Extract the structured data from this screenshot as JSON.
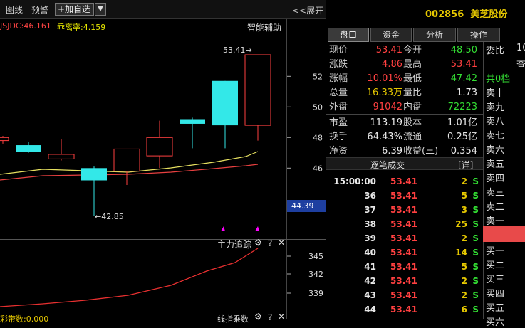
{
  "toolbar": {
    "items": [
      "图线",
      "预警"
    ],
    "add_label": "+加自选",
    "dropdown": "▼",
    "expand_label": "<<展开"
  },
  "indicators": {
    "left_label": "JSJDC:46.161",
    "deviation": "乖离率:4.159",
    "smart_aid": "智能辅助"
  },
  "chart_data": {
    "type": "candlestick",
    "candles": [
      {
        "open": 48.0,
        "close": 47.8,
        "high": 48.1,
        "low": 47.6,
        "color": "red"
      },
      {
        "open": 47.5,
        "close": 47.05,
        "high": 47.7,
        "low": 47.0,
        "color": "cyan"
      },
      {
        "open": 46.6,
        "close": 46.9,
        "high": 47.9,
        "low": 46.5,
        "color": "red"
      },
      {
        "open": 46.0,
        "close": 45.2,
        "high": 46.1,
        "low": 42.85,
        "color": "cyan"
      },
      {
        "open": 45.8,
        "close": 47.25,
        "high": 47.25,
        "low": 44.9,
        "color": "red"
      },
      {
        "open": 46.8,
        "close": 48.0,
        "high": 49.1,
        "low": 46.0,
        "color": "red"
      },
      {
        "open": 49.2,
        "close": 48.9,
        "high": 49.3,
        "low": 47.3,
        "color": "cyan"
      },
      {
        "open": 51.7,
        "close": 48.8,
        "high": 51.7,
        "low": 47.3,
        "color": "cyan"
      },
      {
        "open": 48.8,
        "close": 53.41,
        "high": 53.41,
        "low": 47.8,
        "color": "red"
      }
    ],
    "y_ticks": [
      "52",
      "50",
      "48",
      "46"
    ],
    "current_price": "44.39",
    "high_annotation": "53.41",
    "low_annotation": "42.85",
    "lower_y_ticks": [
      "345",
      "342",
      "339"
    ]
  },
  "lower_panel": {
    "title": "主力追踪",
    "bottom_left": "彩带数:0.000",
    "bottom_right": "线指乘数"
  },
  "stock": {
    "code": "002856",
    "name": "美芝股份"
  },
  "tabs": [
    "盘口",
    "资金",
    "分析",
    "操作"
  ],
  "quote": [
    {
      "l1": "现价",
      "v1": "53.41",
      "c1": "red",
      "l2": "今开",
      "v2": "48.50",
      "c2": "green"
    },
    {
      "l1": "涨跌",
      "v1": "4.86",
      "c1": "red",
      "l2": "最高",
      "v2": "53.41",
      "c2": "red"
    },
    {
      "l1": "涨幅",
      "v1": "10.01%",
      "c1": "red",
      "l2": "最低",
      "v2": "47.42",
      "c2": "green"
    },
    {
      "l1": "总量",
      "v1": "16.33万",
      "c1": "yellow",
      "l2": "量比",
      "v2": "1.73",
      "c2": "white"
    },
    {
      "l1": "外盘",
      "v1": "91042",
      "c1": "red",
      "l2": "内盘",
      "v2": "72223",
      "c2": "green"
    },
    {
      "l1": "市盈",
      "v1": "113.19",
      "c1": "white",
      "l2": "股本",
      "v2": "1.01亿",
      "c2": "white"
    },
    {
      "l1": "换手",
      "v1": "64.43%",
      "c1": "white",
      "l2": "流通",
      "v2": "0.25亿",
      "c2": "white"
    },
    {
      "l1": "净资",
      "v1": "6.39",
      "c1": "white",
      "l2": "收益(三)",
      "v2": "0.354",
      "c2": "white"
    }
  ],
  "trades_header": {
    "title": "逐笔成交",
    "detail": "[详]"
  },
  "trades": [
    {
      "t": "15:00:00",
      "p": "53.41",
      "v": "2",
      "s": "S"
    },
    {
      "t": "36",
      "p": "53.41",
      "v": "5",
      "s": "S"
    },
    {
      "t": "37",
      "p": "53.41",
      "v": "3",
      "s": "S"
    },
    {
      "t": "38",
      "p": "53.41",
      "v": "25",
      "s": "S"
    },
    {
      "t": "39",
      "p": "53.41",
      "v": "2",
      "s": "S"
    },
    {
      "t": "40",
      "p": "53.41",
      "v": "14",
      "s": "S"
    },
    {
      "t": "41",
      "p": "53.41",
      "v": "5",
      "s": "S"
    },
    {
      "t": "42",
      "p": "53.41",
      "v": "2",
      "s": "S"
    },
    {
      "t": "43",
      "p": "53.41",
      "v": "2",
      "s": "S"
    },
    {
      "t": "44",
      "p": "53.41",
      "v": "6",
      "s": "S"
    }
  ],
  "orderbook": {
    "weibi": "委比",
    "query": "查",
    "total": "共0档",
    "sells": [
      "卖十",
      "卖九",
      "卖八",
      "卖七",
      "卖六",
      "卖五",
      "卖四",
      "卖三",
      "卖二",
      "卖一"
    ],
    "buys": [
      "买一",
      "买二",
      "买三",
      "买四",
      "买五",
      "买六"
    ]
  }
}
